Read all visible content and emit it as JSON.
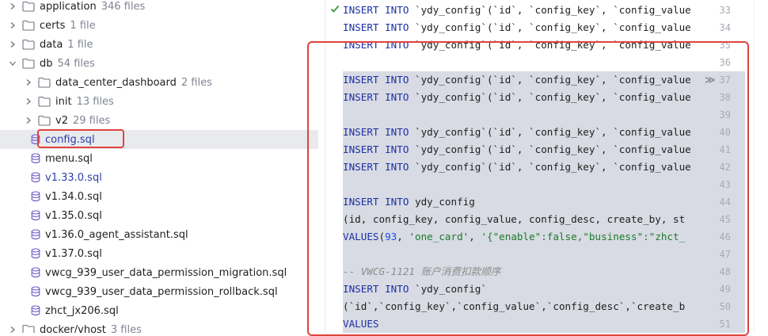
{
  "tree": {
    "items": [
      {
        "name": "application",
        "count": "346 files",
        "type": "folder",
        "expanded": false,
        "indent": 0
      },
      {
        "name": "certs",
        "count": "1 file",
        "type": "folder",
        "expanded": false,
        "indent": 0
      },
      {
        "name": "data",
        "count": "1 file",
        "type": "folder",
        "expanded": false,
        "indent": 0
      },
      {
        "name": "db",
        "count": "54 files",
        "type": "folder",
        "expanded": true,
        "indent": 0
      },
      {
        "name": "data_center_dashboard",
        "count": "2 files",
        "type": "folder",
        "expanded": false,
        "indent": 1
      },
      {
        "name": "init",
        "count": "13 files",
        "type": "folder",
        "expanded": false,
        "indent": 1
      },
      {
        "name": "v2",
        "count": "29 files",
        "type": "folder",
        "expanded": false,
        "indent": 1
      },
      {
        "name": "config.sql",
        "count": "",
        "type": "sql",
        "selected": true,
        "color": "blue",
        "indent": 1
      },
      {
        "name": "menu.sql",
        "count": "",
        "type": "sql",
        "indent": 1
      },
      {
        "name": "v1.33.0.sql",
        "count": "",
        "type": "sql",
        "color": "blue",
        "indent": 1
      },
      {
        "name": "v1.34.0.sql",
        "count": "",
        "type": "sql",
        "indent": 1
      },
      {
        "name": "v1.35.0.sql",
        "count": "",
        "type": "sql",
        "indent": 1
      },
      {
        "name": "v1.36.0_agent_assistant.sql",
        "count": "",
        "type": "sql",
        "indent": 1
      },
      {
        "name": "v1.37.0.sql",
        "count": "",
        "type": "sql",
        "indent": 1
      },
      {
        "name": "vwcg_939_user_data_permission_migration.sql",
        "count": "",
        "type": "sql",
        "indent": 1
      },
      {
        "name": "vwcg_939_user_data_permission_rollback.sql",
        "count": "",
        "type": "sql",
        "indent": 1
      },
      {
        "name": "zhct_jx206.sql",
        "count": "",
        "type": "sql",
        "indent": 1
      },
      {
        "name": "docker/vhost",
        "count": "3 files",
        "type": "folder",
        "expanded": false,
        "indent": 0
      }
    ]
  },
  "editor": {
    "fold_marker": "≫",
    "line_numbers": [
      "33",
      "34",
      "35",
      "36",
      "37",
      "38",
      "39",
      "40",
      "41",
      "42",
      "43",
      "44",
      "45",
      "46",
      "47",
      "48",
      "49",
      "50",
      "51"
    ],
    "lines": [
      [
        {
          "t": "kw",
          "v": "INSERT INTO"
        },
        {
          "t": "txt",
          "v": " `ydy_config`(`id`, `config_key`, `config_value"
        }
      ],
      [
        {
          "t": "kw",
          "v": "INSERT INTO"
        },
        {
          "t": "txt",
          "v": " `ydy_config`(`id`, `config_key`, `config_value"
        }
      ],
      [
        {
          "t": "kw",
          "v": "INSERT INTO"
        },
        {
          "t": "txt",
          "v": " `ydy_config`(`id`, `config_key`, `config_value"
        }
      ],
      [],
      [
        {
          "t": "kw",
          "v": "INSERT INTO"
        },
        {
          "t": "txt",
          "v": " `ydy_config`(`id`, `config_key`, `config_value"
        }
      ],
      [
        {
          "t": "kw",
          "v": "INSERT INTO"
        },
        {
          "t": "txt",
          "v": " `ydy_config`(`id`, `config_key`, `config_value"
        }
      ],
      [],
      [
        {
          "t": "kw",
          "v": "INSERT INTO"
        },
        {
          "t": "txt",
          "v": " `ydy_config`(`id`, `config_key`, `config_value"
        }
      ],
      [
        {
          "t": "kw",
          "v": "INSERT INTO"
        },
        {
          "t": "txt",
          "v": " `ydy_config`(`id`, `config_key`, `config_value"
        }
      ],
      [
        {
          "t": "kw",
          "v": "INSERT INTO"
        },
        {
          "t": "txt",
          "v": " `ydy_config`(`id`, `config_key`, `config_value"
        }
      ],
      [],
      [
        {
          "t": "kw",
          "v": "INSERT INTO"
        },
        {
          "t": "txt",
          "v": " ydy_config"
        }
      ],
      [
        {
          "t": "txt",
          "v": "(id, config_key, config_value, config_desc, create_by, st"
        }
      ],
      [
        {
          "t": "kw",
          "v": "VALUES"
        },
        {
          "t": "txt",
          "v": "("
        },
        {
          "t": "num",
          "v": "93"
        },
        {
          "t": "txt",
          "v": ", "
        },
        {
          "t": "str",
          "v": "'one_card'"
        },
        {
          "t": "txt",
          "v": ", "
        },
        {
          "t": "str",
          "v": "'{\"enable\":false,\"business\":\"zhct_"
        }
      ],
      [],
      [
        {
          "t": "cmt",
          "v": "-- VWCG-1121 账户消费扣款顺序"
        }
      ],
      [
        {
          "t": "kw",
          "v": "INSERT INTO"
        },
        {
          "t": "txt",
          "v": " `ydy_config`"
        }
      ],
      [
        {
          "t": "txt",
          "v": "(`id`,`config_key`,`config_value`,`config_desc`,`create_b"
        }
      ],
      [
        {
          "t": "kw",
          "v": "VALUES"
        }
      ]
    ]
  }
}
